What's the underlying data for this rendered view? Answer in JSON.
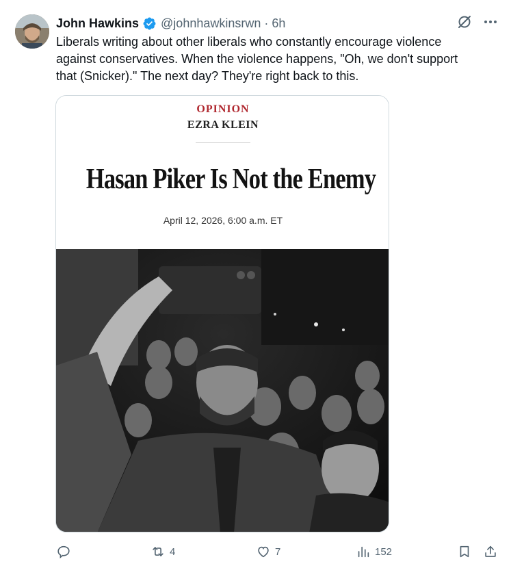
{
  "tweet": {
    "author_name": "John Hawkins",
    "handle": "@johnhawkinsrwn",
    "separator": "·",
    "time": "6h",
    "text_lines": [
      "Liberals writing about other liberals who constantly encourage violence",
      "against conservatives. When the violence happens, \"Oh, we don't support",
      "that (Snicker).\" The next day? They're right back to this."
    ]
  },
  "article": {
    "section": "OPINION",
    "author": "EZRA KLEIN",
    "headline": "Hasan Piker Is Not the Enemy",
    "date": "April 12, 2026, 6:00 a.m. ET"
  },
  "actions": {
    "replies": "",
    "retweets": "4",
    "likes": "7",
    "views": "152"
  },
  "colors": {
    "accent": "#1d9bf0",
    "secondary_text": "#536471",
    "opinion_red": "#b0282f"
  },
  "icons": [
    "verified-badge-icon",
    "grok-icon",
    "more-icon",
    "reply-icon",
    "retweet-icon",
    "like-icon",
    "views-icon",
    "bookmark-icon",
    "share-icon"
  ]
}
